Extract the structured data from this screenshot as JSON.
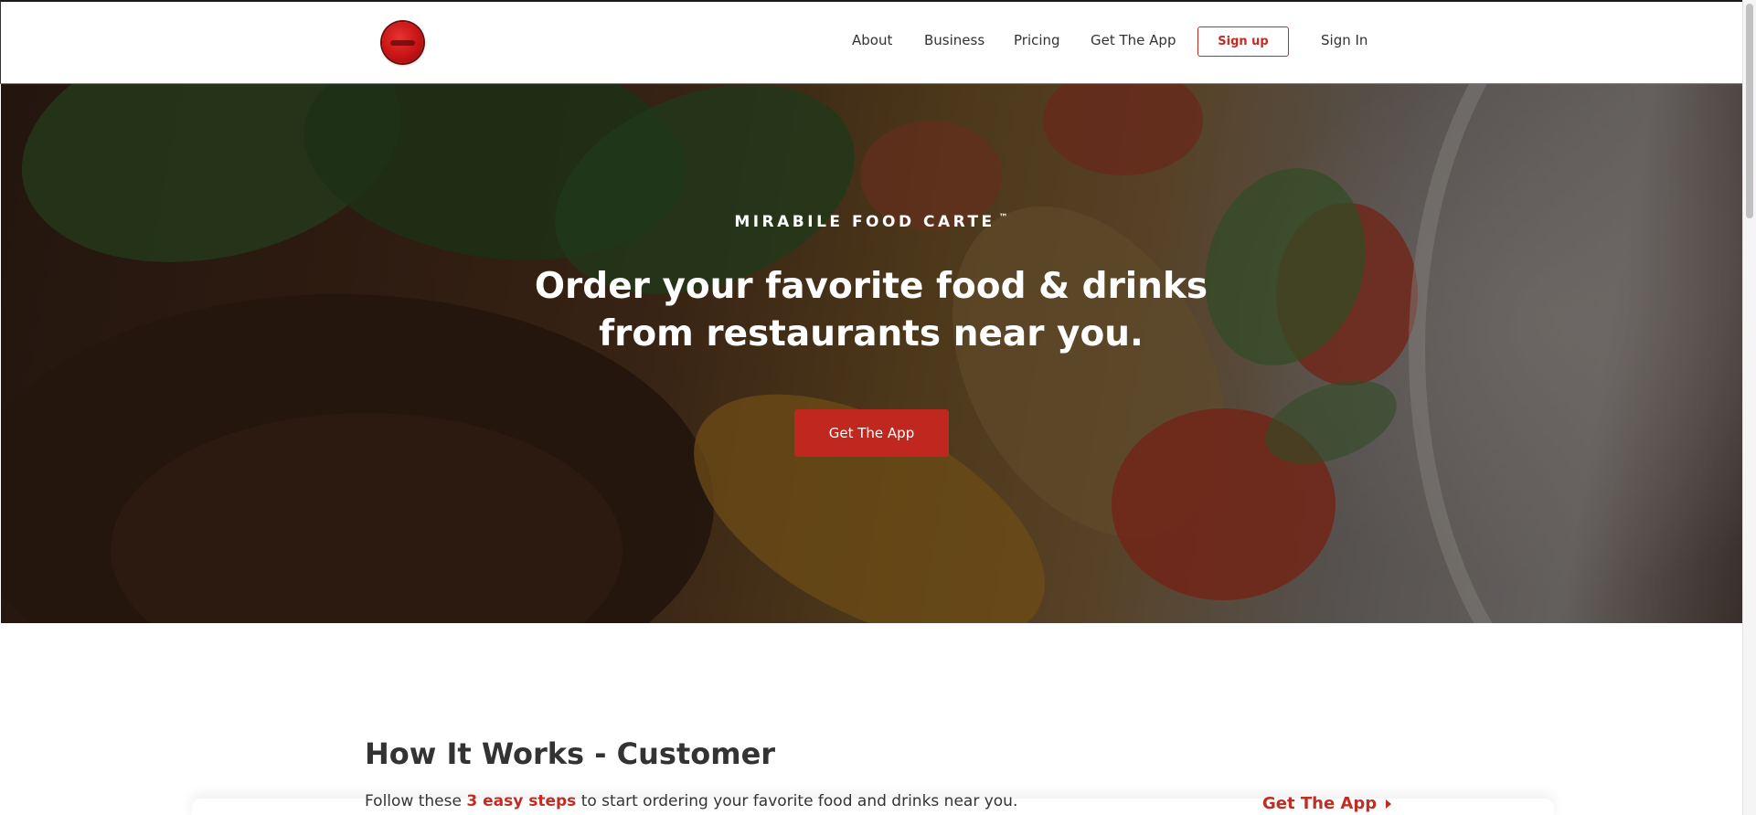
{
  "nav": {
    "logo_icon": "mirabile-logo-icon",
    "about": "About",
    "business": "Business",
    "pricing": "Pricing",
    "get_app": "Get The App",
    "sign_up": "Sign up",
    "sign_in": "Sign In"
  },
  "hero": {
    "brand": "MIRABILE FOOD CARTE",
    "trademark": "™",
    "title_line1": "Order your favorite food & drinks",
    "title_line2": "from restaurants near you.",
    "cta": "Get The App"
  },
  "how_it_works": {
    "title": "How It Works - Customer",
    "sub_before": "Follow these ",
    "sub_highlight": "3 easy steps",
    "sub_after": " to start ordering your favorite food and drinks near you.",
    "link": "Get The App",
    "link_icon": "caret-right-icon"
  },
  "colors": {
    "accent": "#c12d23",
    "button_fill": "#c0271e",
    "text": "#333333"
  }
}
